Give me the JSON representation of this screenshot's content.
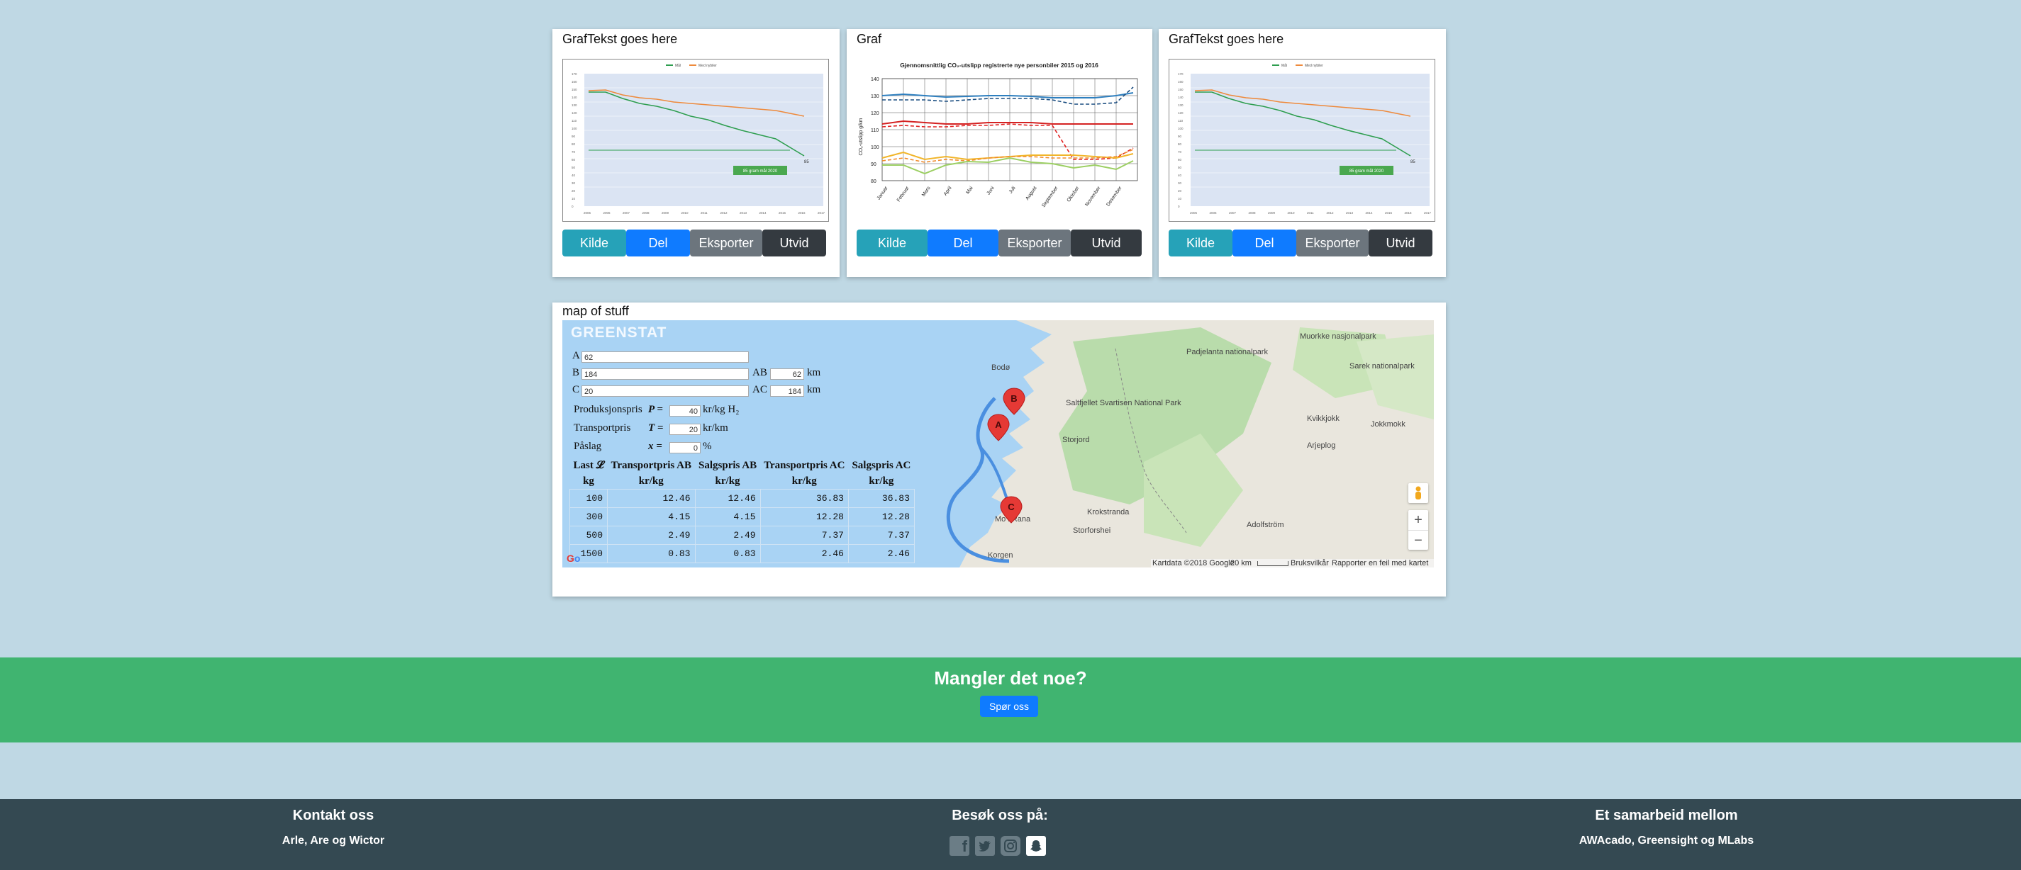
{
  "cards": [
    {
      "title": "GrafTekst goes here"
    },
    {
      "title": "Graf"
    },
    {
      "title": "GrafTekst goes here"
    }
  ],
  "buttons": {
    "kilde": "Kilde",
    "del": "Del",
    "eksporter": "Eksporter",
    "utvid": "Utvid"
  },
  "mini_chart": {
    "legend": [
      "Mål",
      "Med nybiler"
    ],
    "badge": "85 gram mål 2020",
    "x_ticks": [
      "2005",
      "2006",
      "2007",
      "2008",
      "2009",
      "2010",
      "2011",
      "2012",
      "2013",
      "2014",
      "2015",
      "2016",
      "2017"
    ],
    "y_ticks": [
      "0",
      "10",
      "20",
      "30",
      "40",
      "50",
      "60",
      "70",
      "80",
      "90",
      "100",
      "110",
      "120",
      "130",
      "140",
      "150",
      "160",
      "170"
    ],
    "end_value": "85"
  },
  "co2_chart": {
    "title": "Gjennomsnittlig CO₂-utslipp registrerte nye personbiler 2015 og 2016",
    "ylabel": "CO₂-utslipp g/km",
    "y_ticks": [
      "80",
      "90",
      "100",
      "110",
      "120",
      "130",
      "140"
    ],
    "months": [
      "Januar",
      "Februar",
      "Mars",
      "April",
      "Mai",
      "Juni",
      "Juli",
      "August",
      "September",
      "Oktober",
      "November",
      "Desember"
    ]
  },
  "map": {
    "card_title": "map of stuff",
    "brand": "GREENSTAT",
    "fields": {
      "a_label": "A",
      "a_value": "62",
      "b_label": "B",
      "b_value": "184",
      "c_label": "C",
      "c_value": "20",
      "ab_label": "AB",
      "ab_value": "62",
      "ab_unit": "km",
      "ac_label": "AC",
      "ac_value": "184",
      "ac_unit": "km",
      "p_label": "Produksjonspris",
      "p_sym": "P =",
      "p_value": "40",
      "p_unit": "kr/kg H₂",
      "t_label": "Transportpris",
      "t_sym": "T =",
      "t_value": "20",
      "t_unit": "kr/km",
      "x_label": "Påslag",
      "x_sym": "x =",
      "x_value": "0",
      "x_unit": "%"
    },
    "table": {
      "headers": [
        "Last 𝓛",
        "Transportpris AB",
        "Salgspris AB",
        "Transportpris AC",
        "Salgspris AC"
      ],
      "units": [
        "kg",
        "kr/kg",
        "kr/kg",
        "kr/kg",
        "kr/kg"
      ],
      "rows": [
        [
          "100",
          "12.46",
          "12.46",
          "36.83",
          "36.83"
        ],
        [
          "300",
          "4.15",
          "4.15",
          "12.28",
          "12.28"
        ],
        [
          "500",
          "2.49",
          "2.49",
          "7.37",
          "7.37"
        ],
        [
          "1500",
          "0.83",
          "0.83",
          "2.46",
          "2.46"
        ]
      ]
    },
    "places": [
      {
        "name": "Muorkke nasjonalpark"
      },
      {
        "name": "Padjelanta nationalpark"
      },
      {
        "name": "Sarek nationalpark"
      },
      {
        "name": "Saltfjellet Svartisen National Park"
      },
      {
        "name": "Bodø"
      },
      {
        "name": "Krokstranda"
      },
      {
        "name": "Storforshei"
      },
      {
        "name": "Mo i Rana"
      },
      {
        "name": "Jokkmokk"
      },
      {
        "name": "Arjeplog"
      },
      {
        "name": "Adolfström"
      },
      {
        "name": "Korgen"
      },
      {
        "name": "Kvikkjokk"
      },
      {
        "name": "Storjord"
      }
    ],
    "markers": [
      "A",
      "B",
      "C"
    ],
    "attribution": "Kartdata ©2018 Google",
    "scale": "20 km",
    "terms": "Bruksvilkår",
    "report": "Rapporter en feil med kartet",
    "zoom_in": "+",
    "zoom_out": "−"
  },
  "cta": {
    "heading": "Mangler det noe?",
    "button": "Spør oss"
  },
  "footer": {
    "contact_title": "Kontakt oss",
    "contact_names": "Arle, Are og Wictor",
    "visit_title": "Besøk oss på:",
    "collab_title": "Et samarbeid mellom",
    "collab_names": "AWAcado, Greensight og MLabs"
  },
  "social_icons": [
    "facebook-icon",
    "twitter-icon",
    "instagram-icon",
    "snapchat-icon"
  ]
}
